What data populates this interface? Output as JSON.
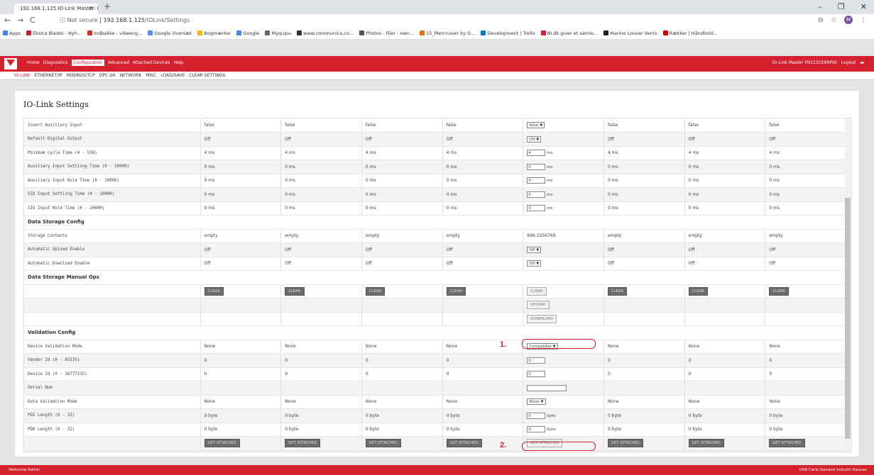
{
  "browser": {
    "tab_title": "192.168.1.125 IO-Link Master: IO",
    "url_prefix": "Not secure",
    "url_host": "192.168.1.125",
    "url_path": "/IOLink/Settings",
    "avatar": "M",
    "bookmarks": [
      "Apps",
      "Ekstra Bladet - Nyh...",
      "Indbakke - vibeeng...",
      "Google Oversæt",
      "Bogmærker",
      "Google",
      "Myquipu",
      "www.communica.co...",
      "Photos - Filer - own...",
      "15_Mercruiser by G...",
      "Development | Trello",
      "Ni.dk giver et samle...",
      "Marine Louver Vents",
      "Rækker | Håndbold..."
    ]
  },
  "app": {
    "menu": [
      "Home",
      "Diagnostics",
      "Configuration",
      "Advanced",
      "Attached Devices",
      "Help"
    ],
    "active_menu": "Configuration",
    "device": "IO-Link Master YN115CE8RPIO",
    "logout": "Logout",
    "subnav": [
      "IO-LINK",
      "ETHERNET/IP",
      "MODBUS/TCP",
      "OPC UA",
      "NETWORK",
      "MISC",
      "LOAD/SAVE",
      "CLEAR SETTINGS"
    ]
  },
  "panel_title": "IO-Link Settings",
  "rows": [
    {
      "label": "Invert Auxiliary Input",
      "v": "false",
      "port5": "false"
    },
    {
      "label": "Default Digital Output",
      "v": "Off",
      "port5": "Off"
    },
    {
      "label": "Minimum Cycle Time (4 - 538)",
      "v": "4 ms",
      "port5": "4",
      "unit": "ms"
    },
    {
      "label": "Auxiliary Input Settling Time (0 - 10000)",
      "v": "0 ms",
      "port5": "0",
      "unit": "ms"
    },
    {
      "label": "Auxiliary Input Hold Time (0 - 10000)",
      "v": "0 ms",
      "port5": "0",
      "unit": "ms"
    },
    {
      "label": "SIO Input Settling Time (0 - 10000)",
      "v": "0 ms",
      "port5": "0",
      "unit": "ms"
    },
    {
      "label": "SIO Input Hold Time (0 - 10000)",
      "v": "0 ms",
      "port5": "0",
      "unit": "ms"
    },
    {
      "section": "Data Storage Config"
    },
    {
      "label": "Storage Contents",
      "v": "empty",
      "port5": "896:1056769"
    },
    {
      "label": "Automatic Upload Enable",
      "v": "Off",
      "port5": "Off"
    },
    {
      "label": "Automatic Download Enable",
      "v": "Off",
      "port5": "Off"
    },
    {
      "section": "Data Storage Manual Ops"
    },
    {
      "label": "",
      "v": "CLEAR",
      "port5": "CLEAR"
    },
    {
      "label": "",
      "v": "",
      "port5": "UPLOAD"
    },
    {
      "label": "",
      "v": "",
      "port5": "DOWNLOAD"
    },
    {
      "section": "Validation Config"
    },
    {
      "label": "Device Validation Mode",
      "v": "None",
      "port5": "Compatible"
    },
    {
      "label": "Vendor Id (0 - 65535)",
      "v": "0",
      "port5": "0"
    },
    {
      "label": "Device Id (0 - 16777215)",
      "v": "0",
      "port5": "0"
    },
    {
      "label": "Serial Num",
      "v": "",
      "port5": ""
    },
    {
      "label": "Data Validation Mode",
      "v": "None",
      "port5": "None"
    },
    {
      "label": "PDI Length (0 - 32)",
      "v": "0 byte",
      "port5": "0",
      "unit": "byte"
    },
    {
      "label": "PDO Length (0 - 32)",
      "v": "0 byte",
      "port5": "0",
      "unit": "byte"
    },
    {
      "label": "",
      "v": "GET ATTACHED",
      "port5": "GET ATTACHED"
    }
  ],
  "annotations": [
    "1.",
    "2."
  ],
  "footer": {
    "left": "Welcome Admin",
    "right": "UAB Carlo Gavazzi Industri Kaunas"
  }
}
